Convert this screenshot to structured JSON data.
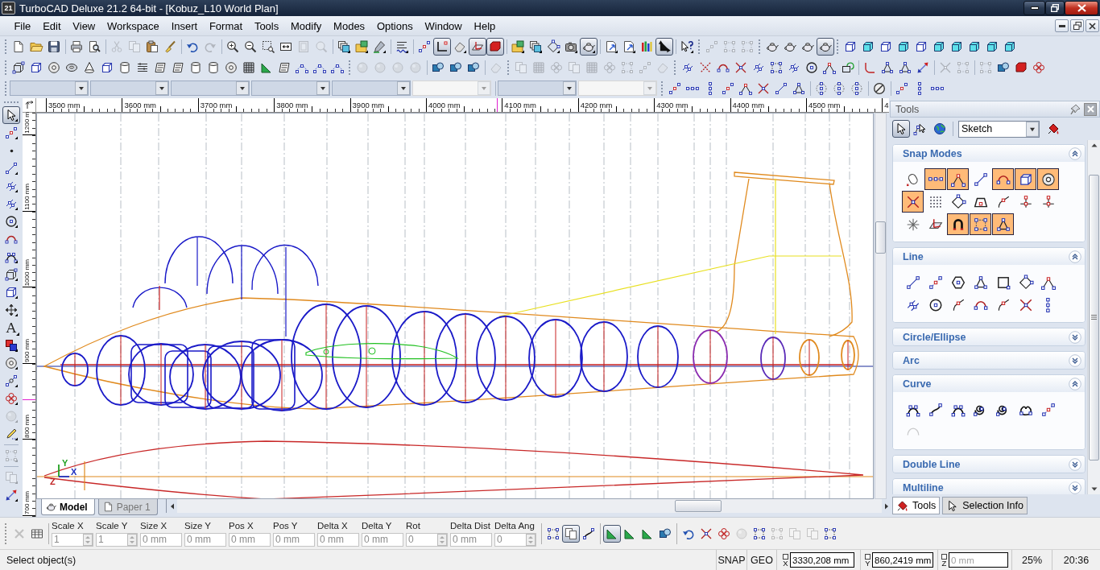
{
  "window": {
    "icon_label": "21",
    "title": "TurboCAD Deluxe 21.2 64-bit - [Kobuz_L10 World Plan]"
  },
  "menu": [
    "File",
    "Edit",
    "View",
    "Workspace",
    "Insert",
    "Format",
    "Tools",
    "Modify",
    "Modes",
    "Options",
    "Window",
    "Help"
  ],
  "toolbars": {
    "row_1": [
      {
        "pressed": false,
        "disabled": false
      },
      {
        "pressed": false,
        "disabled": false
      },
      {
        "pressed": false,
        "disabled": false
      },
      {
        "pressed": false,
        "disabled": false
      },
      {
        "pressed": false,
        "disabled": false
      },
      {
        "pressed": false,
        "disabled": true
      },
      {
        "pressed": false,
        "disabled": true
      },
      {
        "pressed": false,
        "disabled": false
      },
      {
        "pressed": false,
        "disabled": false
      },
      {
        "pressed": false,
        "disabled": false
      },
      {
        "pressed": false,
        "disabled": true
      },
      {
        "pressed": false,
        "disabled": false
      },
      {
        "pressed": false,
        "disabled": false
      },
      {
        "pressed": false,
        "disabled": false
      },
      {
        "pressed": false,
        "disabled": false
      },
      {
        "pressed": false,
        "disabled": true
      },
      {
        "pressed": false,
        "disabled": true
      },
      {
        "pressed": false,
        "disabled": false
      },
      {
        "pressed": false,
        "disabled": false
      },
      {
        "pressed": false,
        "disabled": false
      },
      {
        "pressed": false,
        "disabled": false
      },
      {
        "pressed": false,
        "disabled": false
      },
      {
        "pressed": true,
        "disabled": false
      },
      {
        "pressed": false,
        "disabled": false
      },
      {
        "pressed": true,
        "disabled": false
      },
      {
        "pressed": true,
        "disabled": false
      },
      {
        "pressed": false,
        "disabled": false
      },
      {
        "pressed": false,
        "disabled": false
      },
      {
        "pressed": false,
        "disabled": false
      },
      {
        "pressed": false,
        "disabled": false
      },
      {
        "pressed": true,
        "disabled": false
      },
      {
        "pressed": false,
        "disabled": false
      },
      {
        "pressed": false,
        "disabled": false
      },
      {
        "pressed": false,
        "disabled": false
      },
      {
        "pressed": true,
        "disabled": false
      },
      {
        "pressed": false,
        "disabled": false
      },
      {
        "pressed": false,
        "disabled": true
      },
      {
        "pressed": false,
        "disabled": true
      },
      {
        "pressed": false,
        "disabled": true
      },
      {
        "pressed": false,
        "disabled": false
      },
      {
        "pressed": false,
        "disabled": false
      },
      {
        "pressed": false,
        "disabled": false
      },
      {
        "pressed": true,
        "disabled": false
      },
      {
        "pressed": false,
        "disabled": false
      },
      {
        "pressed": false,
        "disabled": false
      },
      {
        "pressed": false,
        "disabled": false
      },
      {
        "pressed": false,
        "disabled": false
      },
      {
        "pressed": false,
        "disabled": false
      },
      {
        "pressed": false,
        "disabled": false
      },
      {
        "pressed": false,
        "disabled": false
      },
      {
        "pressed": false,
        "disabled": false
      },
      {
        "pressed": false,
        "disabled": false
      },
      {
        "pressed": false,
        "disabled": false
      }
    ],
    "row_2": [
      {
        "disabled": false
      },
      {
        "disabled": false
      },
      {
        "disabled": false
      },
      {
        "disabled": false
      },
      {
        "disabled": false
      },
      {
        "disabled": false
      },
      {
        "disabled": false
      },
      {
        "disabled": false
      },
      {
        "disabled": false
      },
      {
        "disabled": false
      },
      {
        "disabled": false
      },
      {
        "disabled": false
      },
      {
        "disabled": false
      },
      {
        "disabled": false
      },
      {
        "disabled": false
      },
      {
        "disabled": false
      },
      {
        "disabled": false
      },
      {
        "disabled": false
      },
      {
        "disabled": false
      },
      {
        "disabled": true
      },
      {
        "disabled": true
      },
      {
        "disabled": true
      },
      {
        "disabled": true
      },
      {
        "disabled": false
      },
      {
        "disabled": false
      },
      {
        "disabled": false
      },
      {
        "disabled": true
      },
      {
        "disabled": true
      },
      {
        "disabled": true
      },
      {
        "disabled": true
      },
      {
        "disabled": true
      },
      {
        "disabled": true
      },
      {
        "disabled": true
      },
      {
        "disabled": true
      },
      {
        "disabled": true
      },
      {
        "disabled": true
      },
      {
        "disabled": false
      },
      {
        "disabled": false
      },
      {
        "disabled": false
      },
      {
        "disabled": false
      },
      {
        "disabled": false
      },
      {
        "disabled": false
      },
      {
        "disabled": false
      },
      {
        "disabled": false
      },
      {
        "disabled": false
      },
      {
        "disabled": false
      },
      {
        "disabled": false
      },
      {
        "disabled": false
      },
      {
        "disabled": false
      },
      {
        "disabled": false
      },
      {
        "disabled": true
      },
      {
        "disabled": true
      },
      {
        "disabled": true
      },
      {
        "disabled": false
      },
      {
        "disabled": false
      },
      {
        "disabled": false
      }
    ],
    "row_3": {
      "combos": [
        {
          "disabled": false
        },
        {
          "disabled": false
        },
        {
          "disabled": false
        },
        {
          "disabled": false
        },
        {
          "disabled": false
        },
        {
          "disabled": true
        },
        {
          "disabled": false
        },
        {
          "disabled": true
        }
      ]
    }
  },
  "left_toolbar": [
    {
      "pressed": true,
      "disabled": false
    },
    {
      "pressed": false,
      "disabled": false
    },
    {
      "pressed": false,
      "disabled": false
    },
    {
      "pressed": false,
      "disabled": false
    },
    {
      "pressed": false,
      "disabled": false
    },
    {
      "pressed": false,
      "disabled": false
    },
    {
      "pressed": false,
      "disabled": false
    },
    {
      "pressed": false,
      "disabled": false
    },
    {
      "pressed": false,
      "disabled": false
    },
    {
      "pressed": false,
      "disabled": false
    },
    {
      "pressed": false,
      "disabled": false
    },
    {
      "pressed": false,
      "disabled": false
    },
    {
      "pressed": false,
      "disabled": false,
      "label": "A"
    },
    {
      "pressed": false,
      "disabled": false
    },
    {
      "pressed": false,
      "disabled": false
    },
    {
      "pressed": false,
      "disabled": false
    },
    {
      "pressed": false,
      "disabled": false
    },
    {
      "pressed": false,
      "disabled": true
    },
    {
      "pressed": false,
      "disabled": false
    },
    {
      "pressed": false,
      "disabled": true
    },
    {
      "pressed": false,
      "disabled": true
    },
    {
      "pressed": false,
      "disabled": false
    }
  ],
  "rulers": {
    "horizontal": [
      "3500 mm",
      "3600 mm",
      "3700 mm",
      "3800 mm",
      "3900 mm",
      "4000 mm",
      "4100 mm",
      "4200 mm",
      "4300 mm",
      "4400 mm",
      "4500 mm",
      "4"
    ],
    "vertical": [
      "1200 m",
      "1100 mm",
      "1000 mm",
      "900 mm",
      "800 mm",
      "700 mm"
    ]
  },
  "canvas": {
    "axis_labels": [
      {
        "text": "Y",
        "color": "#20a020"
      },
      {
        "text": "Z",
        "color": "#c02020"
      },
      {
        "text": "X",
        "color": "#2030c0"
      }
    ]
  },
  "sheet_tabs": [
    {
      "label": "Model",
      "selected": true
    },
    {
      "label": "Paper 1",
      "selected": false
    }
  ],
  "tools_palette": {
    "title": "Tools",
    "buttons": [
      {
        "pressed": true
      },
      {
        "pressed": false
      },
      {
        "pressed": false
      },
      {
        "pressed": false
      }
    ],
    "mode": "Sketch",
    "sections": [
      {
        "title": "Snap Modes",
        "expanded": true,
        "tools": [
          {
            "on": false
          },
          {
            "on": true
          },
          {
            "on": true
          },
          {
            "on": false
          },
          {
            "on": true
          },
          {
            "on": true
          },
          {
            "on": true
          },
          {
            "on": true
          },
          {
            "on": false
          },
          {
            "on": false
          },
          {
            "on": false
          },
          {
            "on": false
          },
          {
            "on": false
          },
          {
            "on": false
          },
          {
            "on": false
          },
          {
            "on": false
          },
          {
            "on": true
          },
          {
            "on": true
          },
          {
            "on": true
          }
        ]
      },
      {
        "title": "Line",
        "expanded": true
      },
      {
        "title": "Circle/Ellipse",
        "expanded": false
      },
      {
        "title": "Arc",
        "expanded": false
      },
      {
        "title": "Curve",
        "expanded": true,
        "tools": [
          {
            "disabled": false
          },
          {
            "disabled": false
          },
          {
            "disabled": false
          },
          {
            "disabled": false
          },
          {
            "disabled": false
          },
          {
            "disabled": false
          },
          {
            "disabled": false
          },
          {
            "disabled": true
          }
        ]
      },
      {
        "title": "Double Line",
        "expanded": false
      },
      {
        "title": "Multiline",
        "expanded": false
      }
    ]
  },
  "palette_tabs": [
    {
      "label": "Tools",
      "selected": true
    },
    {
      "label": "Selection Info",
      "selected": false
    }
  ],
  "inspector": {
    "tools": [
      {
        "disabled": true
      },
      {
        "disabled": false
      }
    ],
    "fields": [
      {
        "label": "Scale X",
        "value": "1",
        "kind": "spin",
        "disabled": true
      },
      {
        "label": "Scale Y",
        "value": "1",
        "kind": "spin",
        "disabled": true
      },
      {
        "label": "Size X",
        "value": "0 mm",
        "kind": "text",
        "disabled": true
      },
      {
        "label": "Size Y",
        "value": "0 mm",
        "kind": "text",
        "disabled": true
      },
      {
        "label": "Pos X",
        "value": "0 mm",
        "kind": "text",
        "disabled": true
      },
      {
        "label": "Pos Y",
        "value": "0 mm",
        "kind": "text",
        "disabled": true
      },
      {
        "label": "Delta X",
        "value": "0 mm",
        "kind": "text",
        "disabled": true
      },
      {
        "label": "Delta Y",
        "value": "0 mm",
        "kind": "text",
        "disabled": true
      },
      {
        "label": "Rot",
        "value": "0",
        "kind": "spin",
        "disabled": true
      },
      {
        "label": "Delta Dist",
        "value": "0 mm",
        "kind": "text",
        "disabled": true
      },
      {
        "label": "Delta Ang",
        "value": "0",
        "kind": "spin",
        "disabled": true
      }
    ],
    "buttons": [
      {
        "pressed": false,
        "disabled": false
      },
      {
        "pressed": true,
        "disabled": false
      },
      {
        "pressed": false,
        "disabled": false
      },
      {
        "pressed": true,
        "disabled": false
      },
      {
        "pressed": false,
        "disabled": false
      },
      {
        "pressed": false,
        "disabled": false
      },
      {
        "pressed": false,
        "disabled": false
      },
      {
        "pressed": false,
        "disabled": false
      },
      {
        "pressed": false,
        "disabled": false
      },
      {
        "pressed": false,
        "disabled": false
      },
      {
        "pressed": false,
        "disabled": true
      },
      {
        "pressed": false,
        "disabled": false
      },
      {
        "pressed": false,
        "disabled": true
      },
      {
        "pressed": false,
        "disabled": true
      },
      {
        "pressed": false,
        "disabled": true
      },
      {
        "pressed": false,
        "disabled": false
      }
    ]
  },
  "status_bar": {
    "message": "Select object(s)",
    "indicators": [
      "SNAP",
      "GEO"
    ],
    "coordinates": [
      {
        "axis": "X",
        "value": "3330,208 mm",
        "disabled": false
      },
      {
        "axis": "Y",
        "value": "860,2419 mm",
        "disabled": false
      },
      {
        "axis": "Z",
        "value": "0 mm",
        "disabled": true
      }
    ],
    "zoom": "25%",
    "time": "20:36"
  }
}
